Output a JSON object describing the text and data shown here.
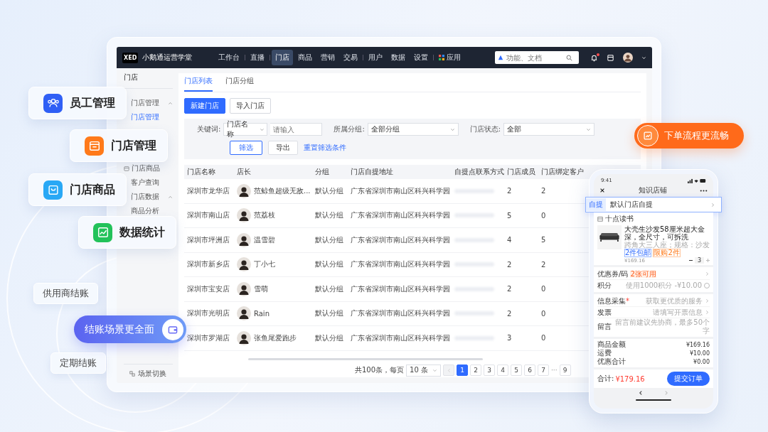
{
  "app_bar": {
    "logo": "XED",
    "brand": "小鹅通运营学堂",
    "search_placeholder": "功能、文档",
    "has_notification": true,
    "menu": [
      {
        "label": "工作台",
        "kind": "text",
        "selected": false,
        "separator_after": true
      },
      {
        "label": "直播",
        "kind": "text",
        "selected": false,
        "separator_after": true
      },
      {
        "label": "门店",
        "kind": "text",
        "selected": true,
        "separator_after": false
      },
      {
        "label": "商品",
        "kind": "text",
        "selected": false,
        "separator_after": false
      },
      {
        "label": "营销",
        "kind": "text",
        "selected": false,
        "separator_after": false
      },
      {
        "label": "交易",
        "kind": "text",
        "selected": false,
        "separator_after": true
      },
      {
        "label": "用户",
        "kind": "text",
        "selected": false,
        "separator_after": false
      },
      {
        "label": "数据",
        "kind": "text",
        "selected": false,
        "separator_after": false
      },
      {
        "label": "设置",
        "kind": "text",
        "selected": false,
        "separator_after": true
      },
      {
        "label": "应用",
        "kind": "apps",
        "selected": false,
        "separator_after": false
      }
    ]
  },
  "sidebar": {
    "title": "门店",
    "footer": "场景切换",
    "items": [
      {
        "label": "门店管理",
        "kind": "group",
        "expanded": true,
        "selected": false
      },
      {
        "label": "门店管理",
        "kind": "link",
        "selected": true
      },
      {
        "label": "门店商品",
        "kind": "icon-link",
        "selected": false
      },
      {
        "label": "客户查询",
        "kind": "link",
        "selected": false
      },
      {
        "label": "门店数据",
        "kind": "group",
        "expanded": true,
        "selected": false
      },
      {
        "label": "商品分析",
        "kind": "link",
        "selected": false
      }
    ]
  },
  "tabs": [
    {
      "label": "门店列表",
      "selected": true
    },
    {
      "label": "门店分组",
      "selected": false
    }
  ],
  "actions": [
    {
      "label": "新建门店",
      "kind": "primary"
    },
    {
      "label": "导入门店",
      "kind": "default"
    }
  ],
  "filters": {
    "keyword_label": "关键词:",
    "keyword_field": "门店名称",
    "keyword_placeholder": "请输入",
    "group_label": "所属分组:",
    "group_value": "全部分组",
    "status_label": "门店状态:",
    "status_value": "全部",
    "buttons": [
      {
        "label": "筛选",
        "kind": "outline"
      },
      {
        "label": "导出",
        "kind": "default"
      },
      {
        "label": "重置筛选条件",
        "kind": "link"
      }
    ]
  },
  "table": {
    "columns": [
      "门店名称",
      "店长",
      "分组",
      "门店自提地址",
      "自提点联系方式",
      "门店成员",
      "门店绑定客户"
    ],
    "rows": [
      {
        "name": "深圳市龙华店",
        "manager": "范鲸鱼超级无敌...",
        "group": "默认分组",
        "address": "广东省深圳市南山区科兴科学园",
        "members": "2",
        "customers": "2"
      },
      {
        "name": "深圳市南山店",
        "manager": "范荔枝",
        "group": "默认分组",
        "address": "广东省深圳市南山区科兴科学园",
        "members": "5",
        "customers": "0"
      },
      {
        "name": "深圳市坪洲店",
        "manager": "温雪碧",
        "group": "默认分组",
        "address": "广东省深圳市南山区科兴科学园",
        "members": "4",
        "customers": "5"
      },
      {
        "name": "深圳市新乡店",
        "manager": "丁小七",
        "group": "默认分组",
        "address": "广东省深圳市南山区科兴科学园",
        "members": "2",
        "customers": "2"
      },
      {
        "name": "深圳市宝安店",
        "manager": "雪萌",
        "group": "默认分组",
        "address": "广东省深圳市南山区科兴科学园",
        "members": "2",
        "customers": "0"
      },
      {
        "name": "深圳市光明店",
        "manager": "Rain",
        "group": "默认分组",
        "address": "广东省深圳市南山区科兴科学园",
        "members": "2",
        "customers": "0"
      },
      {
        "name": "深圳市罗湖店",
        "manager": "张鱼尾爱跑步",
        "group": "默认分组",
        "address": "广东省深圳市南山区科兴科学园",
        "members": "3",
        "customers": "0"
      }
    ]
  },
  "pagination": {
    "total": "共100条，每页",
    "page_size": "10 条",
    "prev_disabled": true,
    "pages": [
      {
        "label": "1",
        "kind": "page",
        "selected": true
      },
      {
        "label": "2",
        "kind": "page",
        "selected": false
      },
      {
        "label": "3",
        "kind": "page",
        "selected": false
      },
      {
        "label": "4",
        "kind": "page",
        "selected": false
      },
      {
        "label": "5",
        "kind": "page",
        "selected": false
      },
      {
        "label": "6",
        "kind": "page",
        "selected": false
      },
      {
        "label": "7",
        "kind": "page",
        "selected": false
      },
      {
        "label": "···",
        "kind": "ellipsis"
      },
      {
        "label": "9",
        "kind": "page",
        "selected": false
      }
    ]
  },
  "features": [
    {
      "label": "员工管理",
      "kind": "people",
      "color": "#2f5ff5"
    },
    {
      "label": "门店管理",
      "kind": "store",
      "color": "#ff7a1a"
    },
    {
      "label": "门店商品",
      "kind": "bag",
      "color": "#29a8f5"
    },
    {
      "label": "数据统计",
      "kind": "chart",
      "color": "#22c25a"
    }
  ],
  "checkout": {
    "tags": [
      "供用商结账",
      "定期结账"
    ],
    "highlight": "结账场景更全面"
  },
  "callout": "下单流程更流畅",
  "phone": {
    "time": "9:41",
    "title": "知识店铺",
    "pickup_tag": "自提",
    "pickup_label": "默认门店自提",
    "shop": "十点读书",
    "product_title": "大壳生沙发58厘米超大金深，全尺寸，可拆洗",
    "product_spec": "跨角大三人座；规格：沙发",
    "product_tags": [
      "2件包邮",
      "限购2件"
    ],
    "product_price": "¥169.16",
    "quantity": "3",
    "rows": [
      {
        "label": "优惠券/码",
        "badge": "2张可用",
        "value": "",
        "kind": "arrow"
      },
      {
        "label": "积分",
        "badge": "",
        "value": "使用1000积分 -¥10.00",
        "kind": "check",
        "checked": false
      },
      {
        "label": "信息采集",
        "required_mark": "*",
        "badge": "",
        "value": "获取更优质的服务",
        "kind": "arrow"
      },
      {
        "label": "发票",
        "badge": "",
        "value": "请填写开票信息",
        "kind": "arrow"
      },
      {
        "label": "留言",
        "badge": "",
        "value": "留言前建议先协商，最多50个字",
        "kind": "plain"
      }
    ],
    "summary": [
      {
        "label": "商品金额",
        "value": "¥169.16"
      },
      {
        "label": "运费",
        "value": "¥10.00"
      },
      {
        "label": "优惠合计",
        "value": "¥0.00"
      }
    ],
    "total_label": "合计:",
    "total_value": "¥179.16",
    "submit": "提交订单"
  }
}
